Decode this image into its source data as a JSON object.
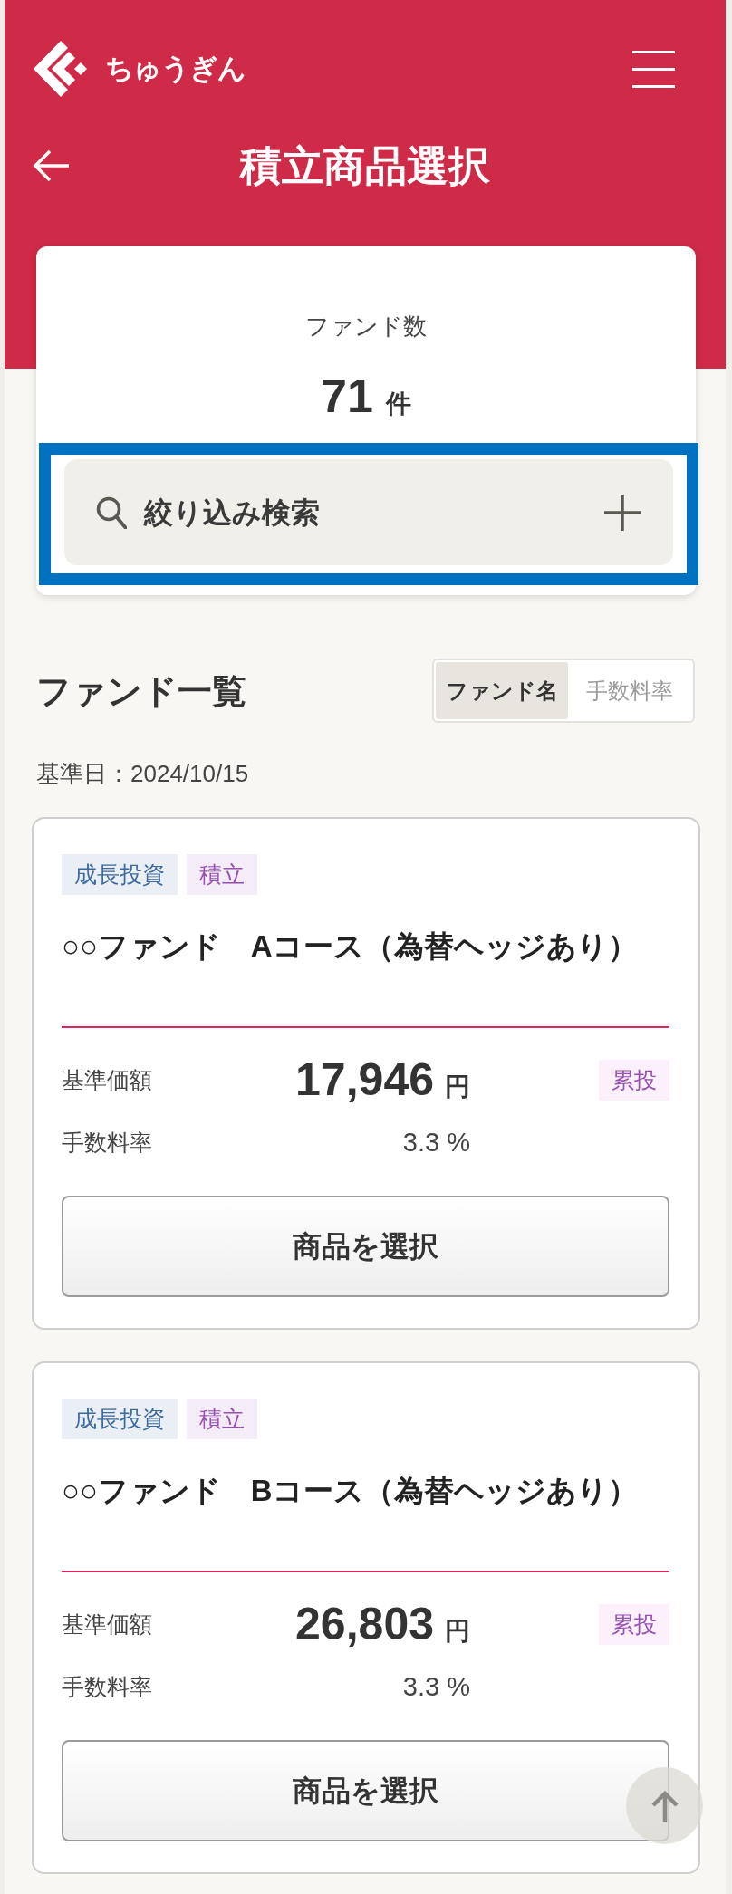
{
  "header": {
    "logo_text": "ちゅうぎん",
    "title": "積立商品選択"
  },
  "fund_count": {
    "label": "ファンド数",
    "value": "71",
    "unit": "件"
  },
  "filter": {
    "label": "絞り込み検索",
    "highlighted": true
  },
  "fund_list": {
    "heading": "ファンド一覧",
    "sort_tabs": [
      {
        "label": "ファンド名",
        "selected": true
      },
      {
        "label": "手数料率",
        "selected": false
      }
    ],
    "base_date": "基準日：2024/10/15"
  },
  "funds": [
    {
      "tags": [
        {
          "label": "成長投資",
          "color": "#3c6aa0"
        },
        {
          "label": "積立",
          "color": "#9a4fb5"
        }
      ],
      "name": "○○ファンド　Aコース（為替ヘッジあり）",
      "price_label": "基準価額",
      "price": "17,946",
      "price_unit": "円",
      "badge": "累投",
      "fee_label": "手数料率",
      "fee": "3.3 %",
      "button": "商品を選択"
    },
    {
      "tags": [
        {
          "label": "成長投資",
          "color": "#3c6aa0"
        },
        {
          "label": "積立",
          "color": "#9a4fb5"
        }
      ],
      "name": "○○ファンド　Bコース（為替ヘッジあり）",
      "price_label": "基準価額",
      "price": "26,803",
      "price_unit": "円",
      "badge": "累投",
      "fee_label": "手数料率",
      "fee": "3.3 %",
      "button": "商品を選択"
    }
  ]
}
